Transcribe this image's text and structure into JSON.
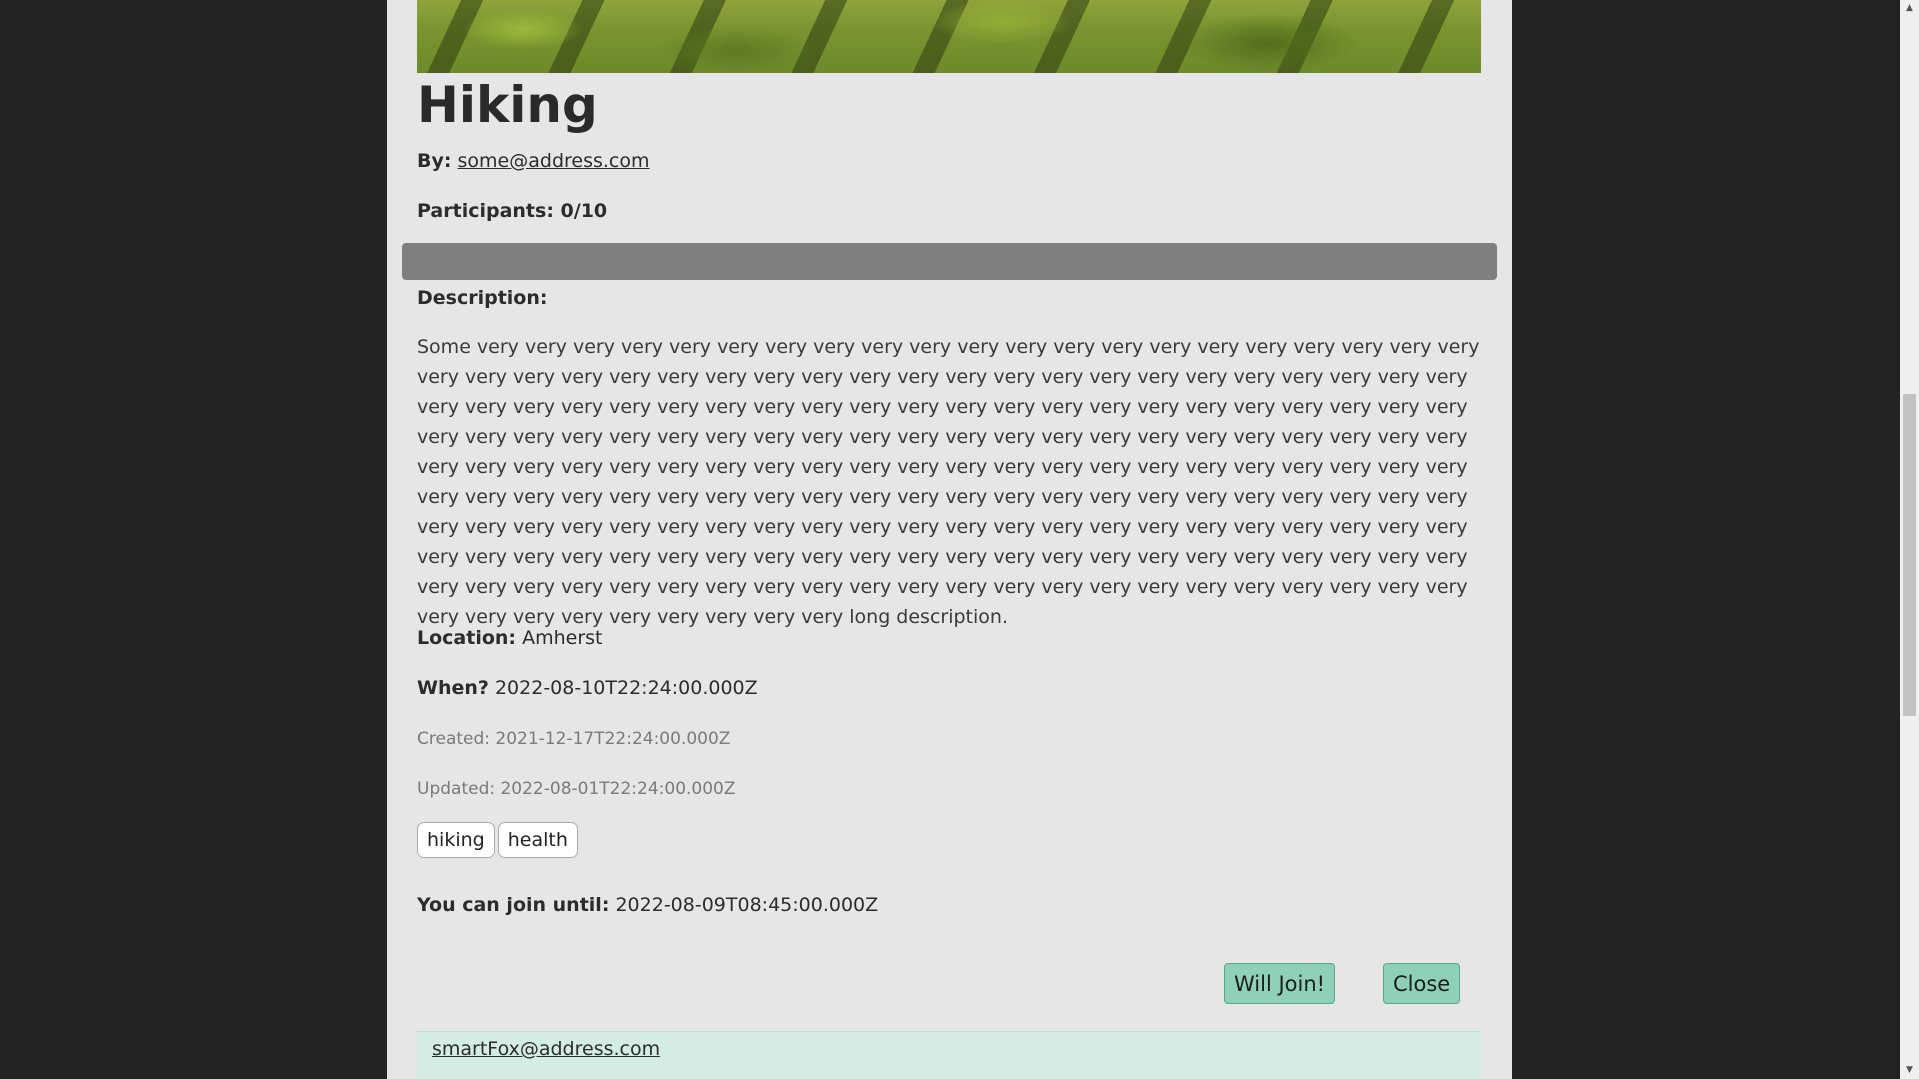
{
  "event": {
    "title": "Hiking",
    "by_label": "By:",
    "by_email": "some@address.com",
    "participants_text": "Participants: 0/10",
    "participants_fill": 0.0,
    "description_label": "Description:",
    "description": "Some very very very very very very very very very very very very very very very very very very very very very very very very very very very very very very very very very very very very very very very very very very very very very very very very very very very very very very very very very very very very very very very very very very very very very very very very very very very very very very very very very very very very very very very very very very very very very very very very very very very very very very very very very very very very very very very very very very very very very very very very very very very very very very very very very very very very very very very very very very very very very very very very very very very very very very very very very very very very very very very very very very very very very very very very very very very very very very very very very very very very very very very very very very very very very very very very very very very very very very very very very very very very very very long description.",
    "location_label": "Location:",
    "location": "Amherst",
    "when_label": "When?",
    "when": "2022-08-10T22:24:00.000Z",
    "created": "Created: 2021-12-17T22:24:00.000Z",
    "updated": "Updated: 2022-08-01T22:24:00.000Z",
    "tags": [
      "hiking",
      "health"
    ],
    "join_until_label": "You can join until:",
    "join_until": "2022-08-09T08:45:00.000Z"
  },
  "actions": {
    "join_label": "Will Join!",
    "close_label": "Close"
  },
  "participants": [
    "smartFox@address.com"
  ],
  "icons": {
    "scroll_up": "scroll-up-arrow-icon",
    "scroll_down": "scroll-down-arrow-icon"
  },
  "colors": {
    "accent_button": "#8fd0b8",
    "progress_track": "#7f7f7f",
    "participant_row": "#d3ede4"
  }
}
